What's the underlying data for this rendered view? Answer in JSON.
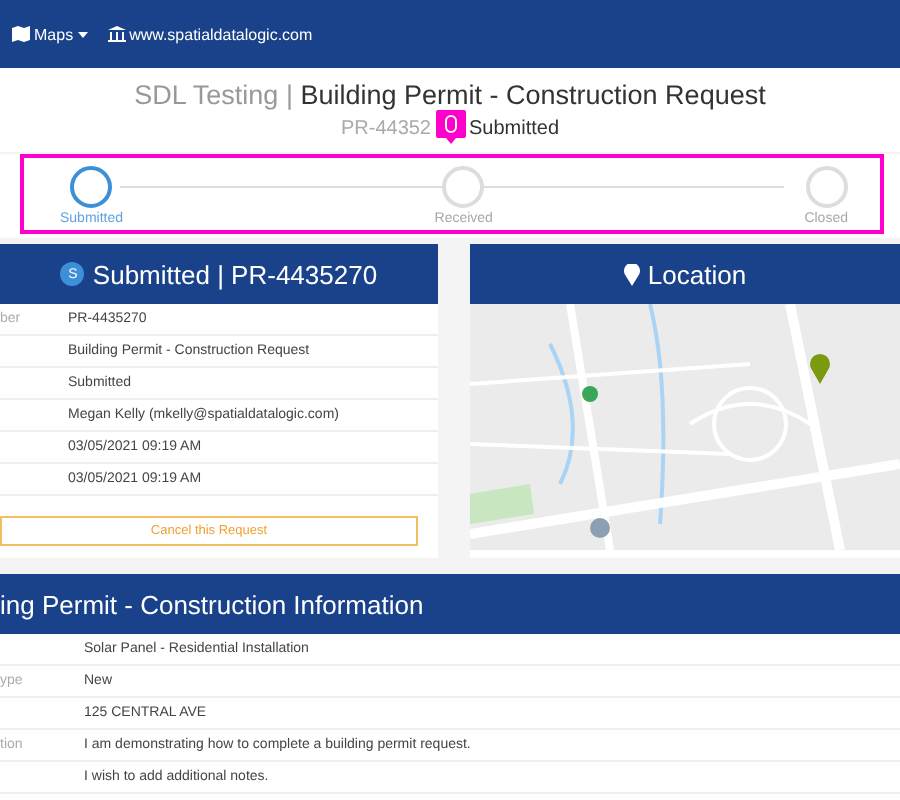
{
  "navbar": {
    "items": [
      {
        "label": "Maps",
        "kind": "dropdown"
      },
      {
        "label": "www.spatialdatalogic.com",
        "kind": "link"
      }
    ]
  },
  "header": {
    "org": "SDL Testing",
    "separator": "|",
    "title": "Building Permit - Construction Request",
    "number": "PR-44352",
    "status": "Submitted"
  },
  "progress": {
    "steps": [
      {
        "label": "Submitted",
        "selected": true
      },
      {
        "label": "Received",
        "selected": false
      },
      {
        "label": "Closed",
        "selected": false
      }
    ]
  },
  "summary": {
    "badge": "S",
    "title": "Submitted | PR-4435270",
    "rows": [
      {
        "label": "ber",
        "value": "PR-4435270"
      },
      {
        "label": "",
        "value": "Building Permit - Construction Request"
      },
      {
        "label": "",
        "value": "Submitted"
      },
      {
        "label": "",
        "value": "Megan Kelly (mkelly@spatialdatalogic.com)"
      },
      {
        "label": "",
        "value": "03/05/2021 09:19 AM"
      },
      {
        "label": "",
        "value": "03/05/2021 09:19 AM"
      }
    ],
    "cancel_button": "Cancel this Request"
  },
  "location": {
    "title": "Location"
  },
  "information": {
    "title": "ing Permit - Construction Information",
    "rows": [
      {
        "label": "",
        "value": "Solar Panel - Residential Installation"
      },
      {
        "label": "ype",
        "value": "New"
      },
      {
        "label": "",
        "value": "125 CENTRAL AVE"
      },
      {
        "label": "tion",
        "value": "I am demonstrating how to complete a building permit request."
      },
      {
        "label": "",
        "value": "I wish to add additional notes."
      }
    ]
  }
}
